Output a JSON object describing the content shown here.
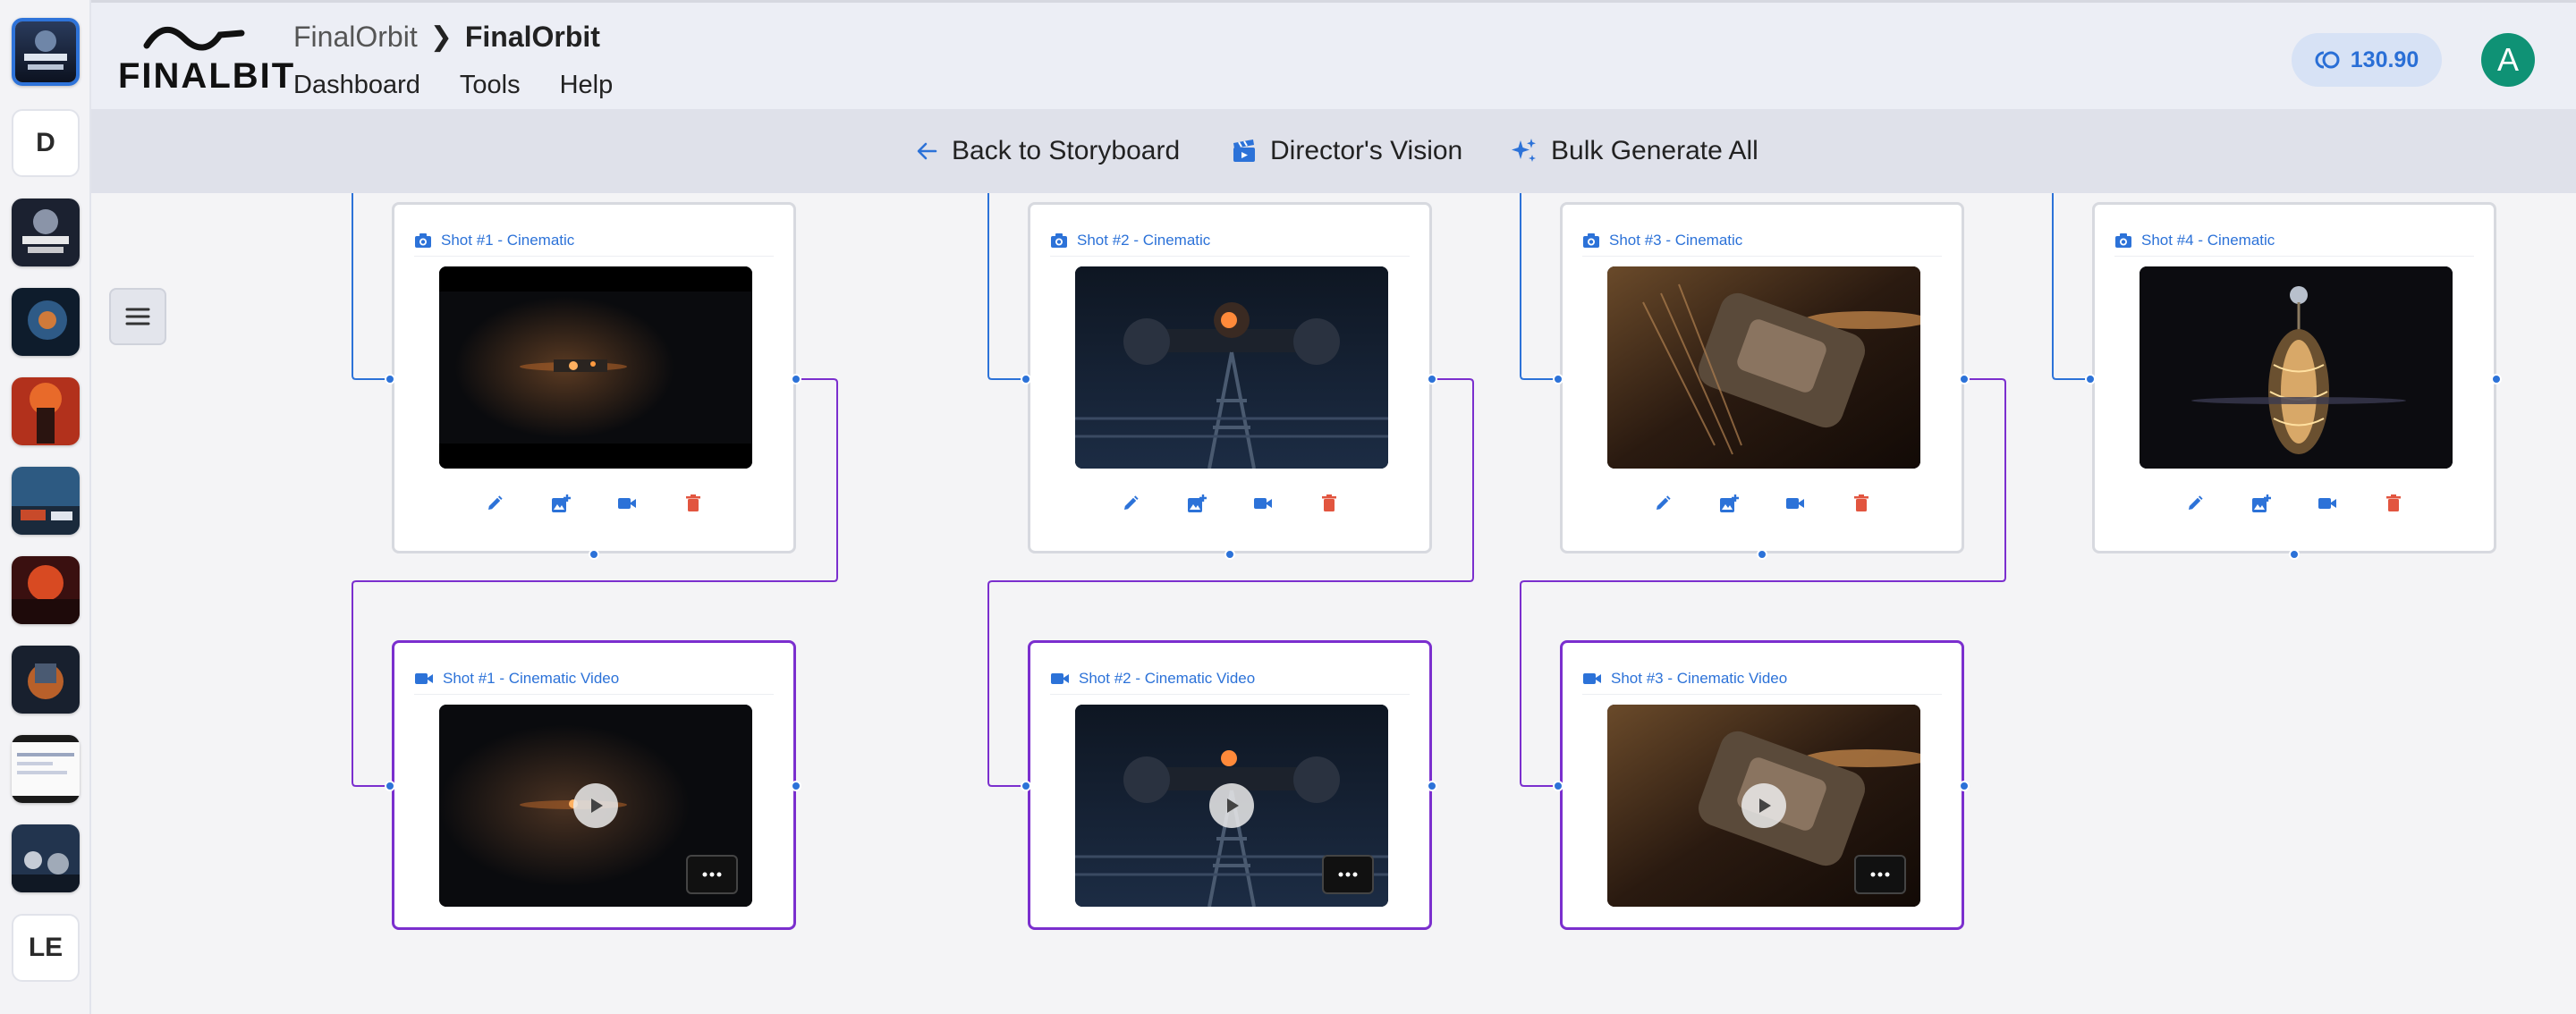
{
  "header": {
    "logo_text": "FINALBIT",
    "breadcrumb": [
      "FinalOrbit",
      "FinalOrbit"
    ],
    "menu": [
      "Dashboard",
      "Tools",
      "Help"
    ],
    "credits": "130.90",
    "avatar_initial": "A"
  },
  "rail": {
    "letters": [
      "D",
      "LE"
    ]
  },
  "toolbar": {
    "back": "Back to Storyboard",
    "vision": "Director's Vision",
    "bulk": "Bulk Generate All"
  },
  "shots": [
    {
      "image_title": "Shot #1 - Cinematic",
      "video_title": "Shot #1 - Cinematic Video"
    },
    {
      "image_title": "Shot #2 - Cinematic",
      "video_title": "Shot #2 - Cinematic Video"
    },
    {
      "image_title": "Shot #3 - Cinematic",
      "video_title": "Shot #3 - Cinematic Video"
    },
    {
      "image_title": "Shot #4 - Cinematic"
    }
  ],
  "icons": {
    "edit": "pencil-icon",
    "add_image": "add-photo-icon",
    "video": "video-camera-icon",
    "delete": "trash-icon"
  },
  "colors": {
    "accent": "#2c72d8",
    "video_border": "#7b2fce",
    "delete": "#e2553f",
    "avatar": "#0f9275"
  }
}
